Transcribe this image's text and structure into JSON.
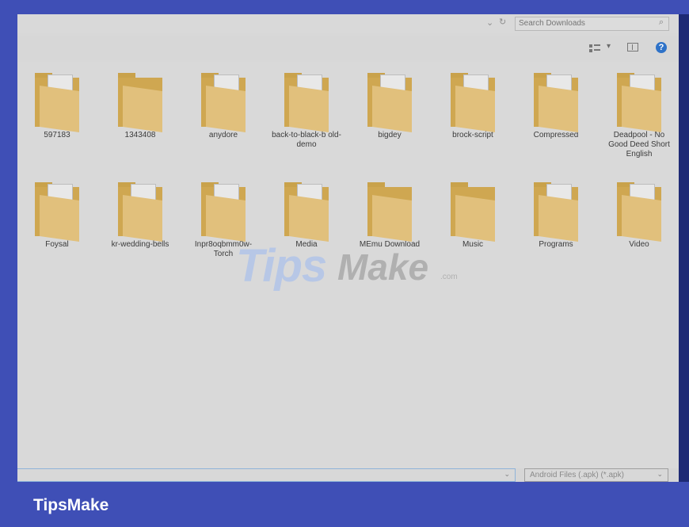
{
  "search": {
    "placeholder": "Search Downloads"
  },
  "folders": [
    {
      "name": "597183"
    },
    {
      "name": "1343408"
    },
    {
      "name": "anydore"
    },
    {
      "name": "back-to-black-b old-demo"
    },
    {
      "name": "bigdey"
    },
    {
      "name": "brock-script"
    },
    {
      "name": "Compressed"
    },
    {
      "name": "Deadpool - No Good Deed Short English"
    },
    {
      "name": "Foysal"
    },
    {
      "name": "kr-wedding-bells"
    },
    {
      "name": "Inpr8oqbmm0w-Torch"
    },
    {
      "name": "Media"
    },
    {
      "name": "MEmu Download"
    },
    {
      "name": "Music"
    },
    {
      "name": "Programs"
    },
    {
      "name": "Video"
    }
  ],
  "bottom": {
    "file_type": "Android Files (.apk) (*.apk)"
  },
  "watermark": {
    "brand": "TipsMake",
    "tips": "Tips",
    "make": "Make",
    "com": ".com"
  },
  "footer": {
    "brand": "TipsMake"
  },
  "colors": {
    "frame": "#3f4fb6",
    "screen_bg": "#d8d8d8",
    "folder": "#cfa751",
    "help": "#2e72c8"
  },
  "icons": {
    "search": "search-icon",
    "help": "help-icon",
    "view": "view-icon"
  }
}
